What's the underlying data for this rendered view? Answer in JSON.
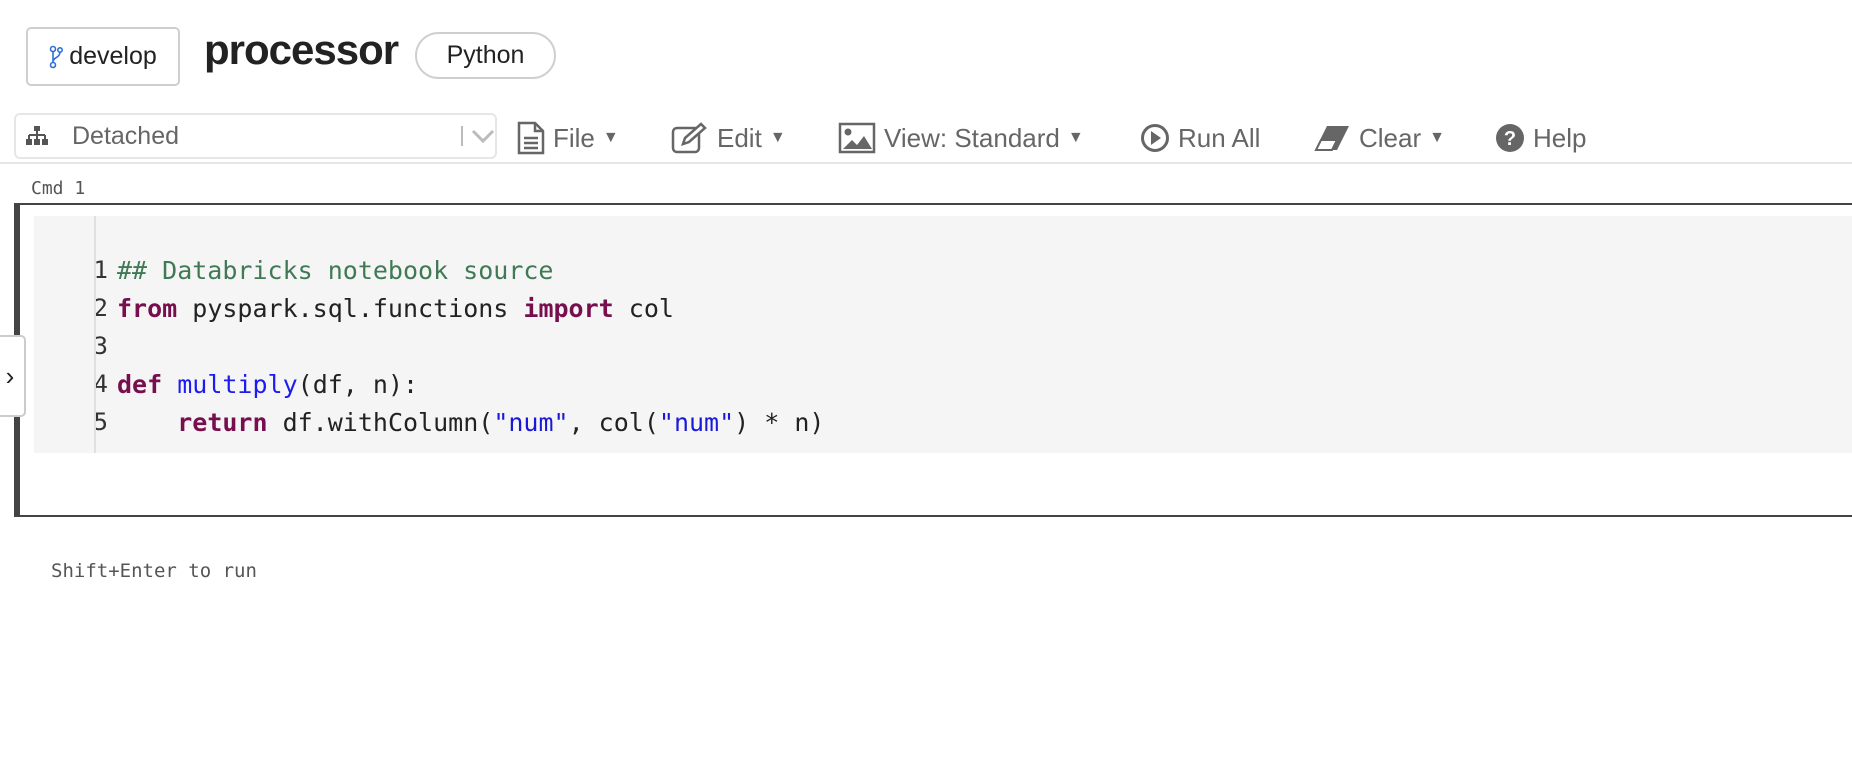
{
  "header": {
    "branch": "develop",
    "title": "processor",
    "language": "Python"
  },
  "toolbar": {
    "cluster": "Detached",
    "file": "File",
    "edit": "Edit",
    "view": "View: Standard",
    "run_all": "Run All",
    "clear": "Clear",
    "help": "Help"
  },
  "cell": {
    "label": "Cmd 1",
    "line_numbers": [
      "1",
      "2",
      "3",
      "4",
      "5"
    ],
    "code": {
      "l1_comment": "## Databricks notebook source",
      "l2_from": "from",
      "l2_mod": " pyspark.sql.functions ",
      "l2_import": "import",
      "l2_rest": " col",
      "l4_def": "def",
      "l4_fn": "multiply",
      "l4_rest": "(df, n):",
      "l5_indent": "    ",
      "l5_return": "return",
      "l5_a": " df.withColumn(",
      "l5_s1": "\"num\"",
      "l5_b": ", col(",
      "l5_s2": "\"num\"",
      "l5_c": ") * n)"
    }
  },
  "hint": "Shift+Enter to run"
}
